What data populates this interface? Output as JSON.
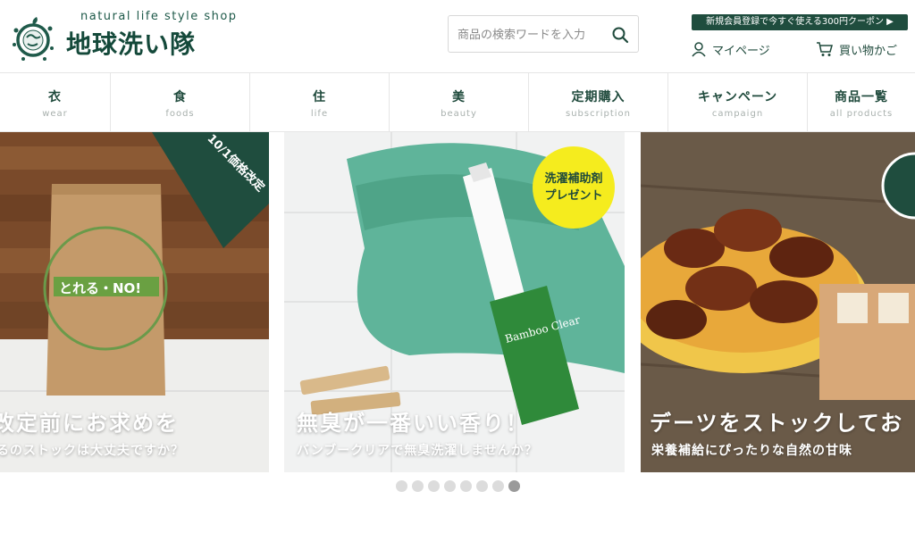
{
  "header": {
    "tagline": "natural life style shop",
    "logo_text": "地球洗い隊",
    "search_placeholder": "商品の検索ワードを入力",
    "coupon": "新規会員登録で今すぐ使える300円クーポン ▶",
    "mypage": "マイページ",
    "cart": "買い物かご"
  },
  "nav": {
    "items": [
      {
        "jp": "衣",
        "en": "wear"
      },
      {
        "jp": "食",
        "en": "foods"
      },
      {
        "jp": "住",
        "en": "life"
      },
      {
        "jp": "美",
        "en": "beauty"
      },
      {
        "jp": "定期購入",
        "en": "subscription"
      },
      {
        "jp": "キャンペーン",
        "en": "campaign"
      },
      {
        "jp": "商品一覧",
        "en": "all products"
      }
    ]
  },
  "slides": [
    {
      "title": "改定前にお求めを",
      "subtitle": "るのストックは大丈夫ですか？",
      "badge": "10/1価格改定",
      "package_label": "とれる・NO!"
    },
    {
      "title": "無臭が一番いい香り！",
      "subtitle": "バンブークリアで無臭洗濯しませんか？",
      "badge_line1": "洗濯補助剤",
      "badge_line2": "プレゼント",
      "bottle_label": "Bamboo Clear"
    },
    {
      "title": "デーツをストックしてお",
      "subtitle": "栄養補給にぴったりな自然の甘味"
    }
  ],
  "pagination": {
    "count": 8,
    "active_index": 7
  },
  "colors": {
    "brand": "#1f4a3c",
    "coupon_bg": "#1f4d3e",
    "badge_yellow": "#f5ec1e",
    "dot_inactive": "#dcdcdc",
    "dot_active": "#9a9a9a"
  }
}
